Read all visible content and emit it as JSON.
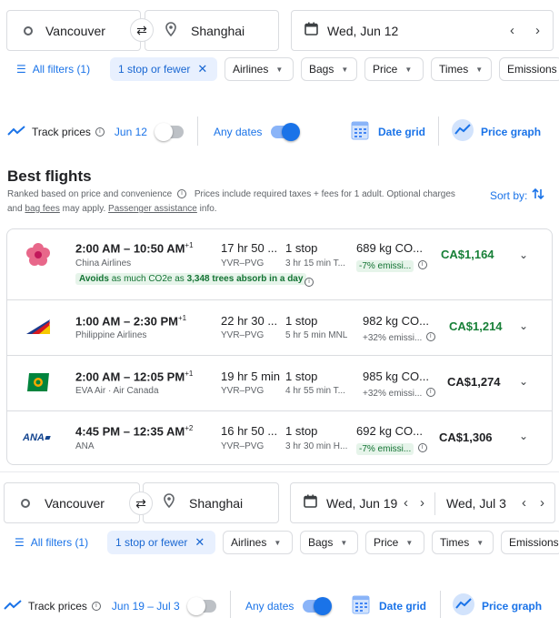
{
  "search1": {
    "origin": "Vancouver",
    "destination": "Shanghai",
    "date": "Wed, Jun 12"
  },
  "filters1": {
    "all_filters": "All filters (1)",
    "stops": "1 stop or fewer",
    "airlines": "Airlines",
    "bags": "Bags",
    "price": "Price",
    "times": "Times",
    "emissions": "Emissions"
  },
  "track1": {
    "label": "Track prices",
    "date": "Jun 12",
    "any_dates": "Any dates",
    "date_grid": "Date grid",
    "price_graph": "Price graph"
  },
  "results": {
    "heading": "Best flights",
    "ranked_note": "Ranked based on price and convenience",
    "price_note": "Prices include required taxes + fees for 1 adult. Optional charges",
    "and": "and",
    "bag_fees": "bag fees",
    "may_apply": "may apply.",
    "passenger_assistance": "Passenger assistance",
    "info": "info.",
    "sort_by": "Sort by:"
  },
  "flights": [
    {
      "times": "2:00 AM – 10:50 AM",
      "day_offset": "+1",
      "airline": "China Airlines",
      "duration": "17 hr 50 ...",
      "route": "YVR–PVG",
      "stops": "1 stop",
      "layover": "3 hr 15 min T...",
      "emissions": "689 kg CO...",
      "emissions_delta": "-7% emissi...",
      "emissions_good": true,
      "price": "CA$1,164",
      "price_color": "#188038",
      "badge_prefix": "Avoids",
      "badge_mid": "as much CO2e as",
      "badge_bold": "3,348 trees absorb in a day"
    },
    {
      "times": "1:00 AM – 2:30 PM",
      "day_offset": "+1",
      "airline": "Philippine Airlines",
      "duration": "22 hr 30 ...",
      "route": "YVR–PVG",
      "stops": "1 stop",
      "layover": "5 hr 5 min MNL",
      "emissions": "982 kg CO...",
      "emissions_delta": "+32% emissi...",
      "emissions_good": false,
      "price": "CA$1,214",
      "price_color": "#188038"
    },
    {
      "times": "2:00 AM – 12:05 PM",
      "day_offset": "+1",
      "airline": "EVA Air · Air Canada",
      "duration": "19 hr 5 min",
      "route": "YVR–PVG",
      "stops": "1 stop",
      "layover": "4 hr 55 min T...",
      "emissions": "985 kg CO...",
      "emissions_delta": "+32% emissi...",
      "emissions_good": false,
      "price": "CA$1,274",
      "price_color": "#202124"
    },
    {
      "times": "4:45 PM – 12:35 AM",
      "day_offset": "+2",
      "airline": "ANA",
      "duration": "16 hr 50 ...",
      "route": "YVR–PVG",
      "stops": "1 stop",
      "layover": "3 hr 30 min H...",
      "emissions": "692 kg CO...",
      "emissions_delta": "-7% emissi...",
      "emissions_good": true,
      "price": "CA$1,306",
      "price_color": "#202124",
      "logo_text": "ANA"
    }
  ],
  "search2": {
    "origin": "Vancouver",
    "destination": "Shanghai",
    "depart": "Wed, Jun 19",
    "return": "Wed, Jul 3"
  },
  "filters2": {
    "all_filters": "All filters (1)",
    "stops": "1 stop or fewer",
    "airlines": "Airlines",
    "bags": "Bags",
    "price": "Price",
    "times": "Times",
    "emissions": "Emissions"
  },
  "track2": {
    "label": "Track prices",
    "date": "Jun 19 – Jul 3",
    "any_dates": "Any dates",
    "date_grid": "Date grid",
    "price_graph": "Price graph"
  }
}
